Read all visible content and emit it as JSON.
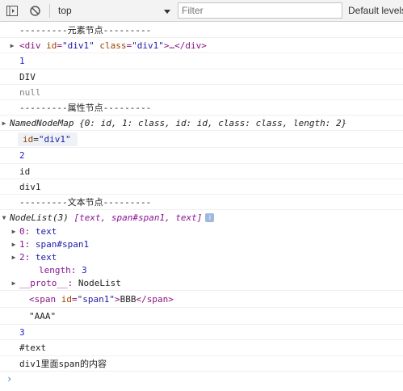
{
  "toolbar": {
    "context": "top",
    "filter_placeholder": "Filter",
    "levels_label": "Default levels"
  },
  "lines": {
    "h1": "---------元素节点---------",
    "el_tag_open": "<div",
    "el_attr1_name": "id",
    "el_attr1_value": "\"div1\"",
    "el_attr2_name": "class",
    "el_attr2_value": "\"div1\"",
    "el_tail": ">…</div>",
    "v1": "1",
    "v2": "DIV",
    "v3": "null",
    "h2": "---------属性节点---------",
    "nnm_name": "NamedNodeMap",
    "nnm_body": "{0: id, 1: class, id: id, class: class, length: 2}",
    "attr_name": "id",
    "attr_value": "\"div1\"",
    "v4": "2",
    "v5": "id",
    "v6": "div1",
    "h3": "---------文本节点---------",
    "nl_name": "NodeList(3)",
    "nl_body": "[text, span#span1, text]",
    "info": "i",
    "c0_key": "0:",
    "c0_val": "text",
    "c1_key": "1:",
    "c1_val": "span#span1",
    "c2_key": "2:",
    "c2_val": "text",
    "len_key": "length:",
    "len_val": "3",
    "proto_key": "__proto__:",
    "proto_val": "NodeList",
    "span_open": "<span",
    "span_attr_name": "id",
    "span_attr_value": "\"span1\"",
    "span_text": "BBB",
    "span_close": "</span>",
    "str_aaa": "\"AAA\"",
    "v7": "3",
    "v8": "#text",
    "v9": "div1里面span的内容"
  },
  "prompt": "›"
}
